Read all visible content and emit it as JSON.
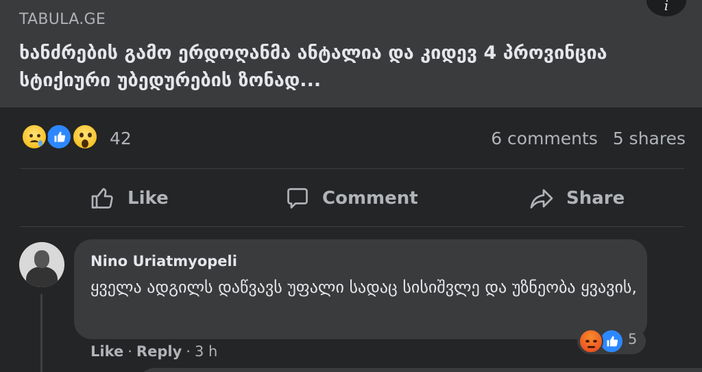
{
  "link_preview": {
    "source": "TABULA.GE",
    "headline": "ხანძრების გამო ერდოღანმა ანტალია და კიდევ 4 პროვინცია სტიქიური უბედურების ზონად...",
    "info_icon": "info-icon"
  },
  "stats": {
    "reaction_icons": [
      "sad-reaction-icon",
      "like-reaction-icon",
      "wow-reaction-icon"
    ],
    "reaction_count": "42",
    "comments": "6 comments",
    "shares": "5 shares"
  },
  "actions": {
    "like": "Like",
    "comment": "Comment",
    "share": "Share"
  },
  "comment": {
    "author": "Nino Uriatmyopeli",
    "text": "ყველა ადგილს დაწვავს უფალი სადაც სისიშვლე და უზნეობა ყვავის,",
    "reaction_icons": [
      "angry-reaction-icon",
      "like-reaction-icon"
    ],
    "reaction_count": "5",
    "like_label": "Like",
    "reply_label": "Reply",
    "time": "3 h"
  },
  "colors": {
    "background": "#242526",
    "card": "#3a3b3c",
    "text_primary": "#e4e6eb",
    "text_secondary": "#b0b3b8",
    "like_blue": "#2d88ff"
  }
}
